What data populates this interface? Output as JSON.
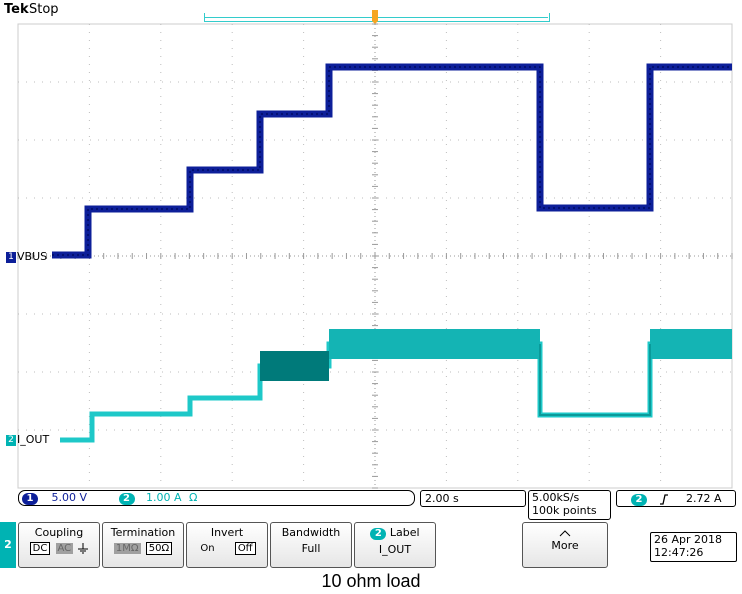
{
  "header": {
    "brand": "Tek",
    "run_state": "Stop"
  },
  "channels": {
    "ch1": {
      "number": "1",
      "label": "VBUS",
      "color": "#0d1f99"
    },
    "ch2": {
      "number": "2",
      "label": "I_OUT",
      "color": "#00b3b3"
    }
  },
  "status": {
    "ch1_scale": "5.00 V",
    "ch2_scale": "1.00 A",
    "ch2_unit": "Ω",
    "timebase": "2.00 s",
    "sample_rate": "5.00kS/s",
    "record_length": "100k points",
    "trigger_source": "2",
    "trigger_slope_icon": "rising-edge-icon",
    "trigger_level": "2.72 A"
  },
  "menu": {
    "channel": "2",
    "coupling": {
      "title": "Coupling",
      "options": [
        "DC",
        "AC"
      ]
    },
    "termination": {
      "title": "Termination",
      "options": [
        "1MΩ",
        "50Ω"
      ]
    },
    "invert": {
      "title": "Invert",
      "options": [
        "On",
        "Off"
      ]
    },
    "bandwidth": {
      "title": "Bandwidth",
      "value": "Full"
    },
    "label": {
      "badge": "2",
      "title": "Label",
      "value": "I_OUT"
    },
    "more": {
      "title": "More"
    },
    "date": "26 Apr 2018",
    "time": "12:47:26"
  },
  "caption": "10 ohm load"
}
